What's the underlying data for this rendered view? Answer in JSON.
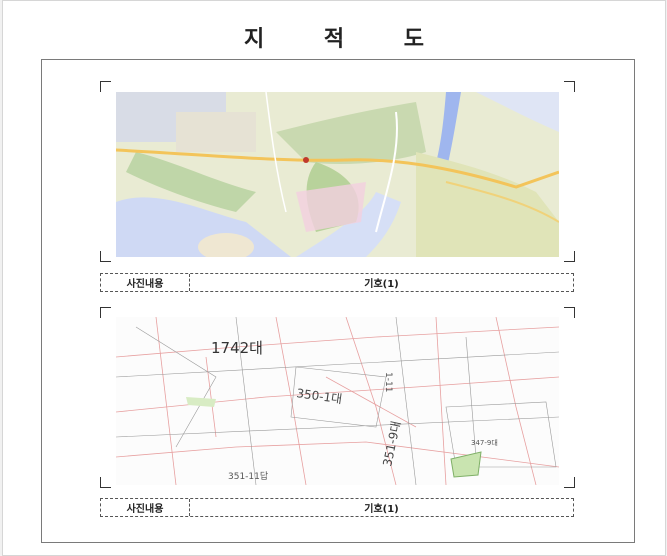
{
  "document": {
    "title": "지 적 도"
  },
  "panels": [
    {
      "caption_label": "사진내용",
      "caption_value": "기호(1)"
    },
    {
      "caption_label": "사진내용",
      "caption_value": "기호(1)",
      "parcel_labels": [
        "1742대",
        "350-1대",
        "351-9대",
        "347-9대",
        "351-11답",
        "1-11"
      ]
    }
  ],
  "colors": {
    "map_land": "#e8ecd2",
    "map_water": "#c8d6f2",
    "map_road": "#f3c45a",
    "map_green": "#b9d39a",
    "frame_border": "#7a7a7a"
  }
}
